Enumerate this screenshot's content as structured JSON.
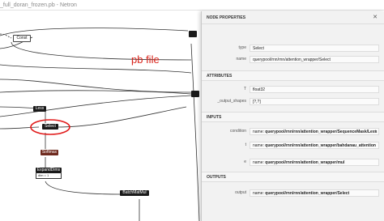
{
  "window": {
    "title": "_full_doran_frozen.pb - Netron",
    "min_glyph": "—",
    "close_glyph": "✕"
  },
  "annotation": "pb file",
  "graph": {
    "nodes": {
      "const": "Const",
      "less": "Less",
      "select": "Select",
      "softmax": "Softmax",
      "expanddims": "ExpandDims",
      "expanddims_attr": "dim = 1",
      "batchmatmul": "BatchMatMul"
    }
  },
  "panel": {
    "title": "NODE PROPERTIES",
    "close_glyph": "✕",
    "type_label": "type",
    "type_value": "Select",
    "name_label": "name",
    "name_value": "querypool/rnn/rnn/attention_wrapper/Select",
    "attributes_heading": "ATTRIBUTES",
    "t_label": "T",
    "t_value": "float32",
    "shapes_label": "_output_shapes",
    "shapes_value": "[?,?]",
    "inputs_heading": "INPUTS",
    "condition_label": "condition",
    "condition_prefix": "name: ",
    "condition_value": "querypool/rnn/rnn/attention_wrapper/SequenceMask/Less",
    "t_input_label": "t",
    "t_input_prefix": "name: ",
    "t_input_value": "querypool/rnn/rnn/attention_wrapper/bahdanau_attention",
    "e_label": "e",
    "e_prefix": "name: ",
    "e_value": "querypool/rnn/rnn/attention_wrapper/mul",
    "outputs_heading": "OUTPUTS",
    "output_label": "output",
    "output_prefix": "name: ",
    "output_value": "querypool/rnn/rnn/attention_wrapper/Select",
    "plus_glyph": "+"
  },
  "colors": {
    "annotation_red": "#d9241b",
    "softmax_node": "#6e2a1e",
    "dark_node": "#1a1a1a"
  }
}
